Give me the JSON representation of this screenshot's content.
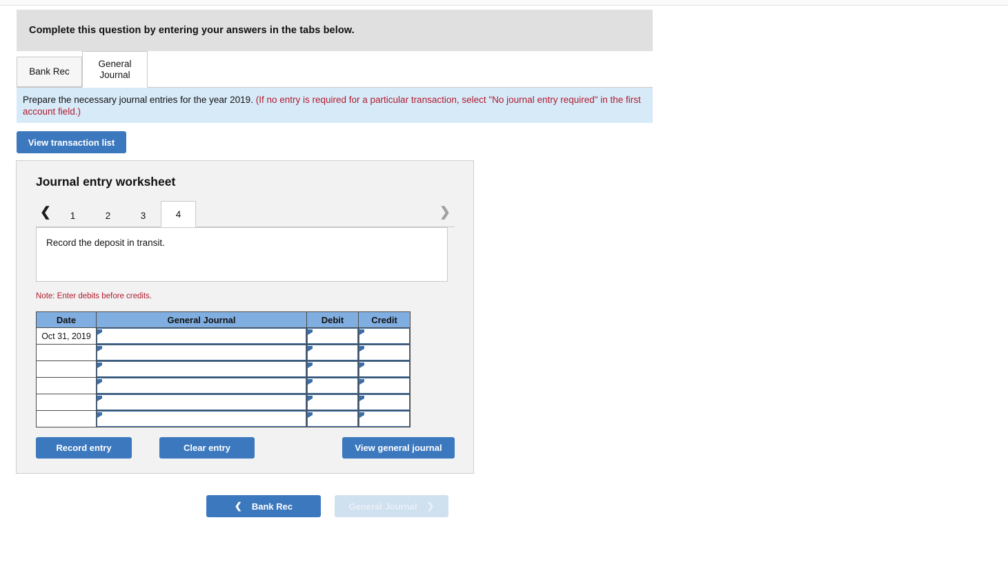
{
  "question": {
    "header": "Complete this question by entering your answers in the tabs below."
  },
  "tabs": [
    {
      "label": "Bank Rec",
      "name": "tab-bank-rec",
      "active": false
    },
    {
      "label": "General Journal",
      "name": "tab-general-journal",
      "active": true
    }
  ],
  "instructions": {
    "main": "Prepare the necessary journal entries for the year 2019.",
    "hint": "(If no entry is required for a particular transaction, select \"No journal entry required\" in the first account field.)"
  },
  "toolbar": {
    "view_transaction_list": "View transaction list"
  },
  "worksheet": {
    "title": "Journal entry worksheet",
    "pager": {
      "prev_icon": "chevron-left",
      "next_icon": "chevron-right",
      "pages": [
        "1",
        "2",
        "3",
        "4"
      ],
      "active_page": "4"
    },
    "transaction_description": "Record the deposit in transit.",
    "note": "Note: Enter debits before credits.",
    "table": {
      "columns": [
        "Date",
        "General Journal",
        "Debit",
        "Credit"
      ],
      "rows": [
        {
          "date": "Oct 31, 2019",
          "general_journal": "",
          "debit": "",
          "credit": ""
        },
        {
          "date": "",
          "general_journal": "",
          "debit": "",
          "credit": ""
        },
        {
          "date": "",
          "general_journal": "",
          "debit": "",
          "credit": ""
        },
        {
          "date": "",
          "general_journal": "",
          "debit": "",
          "credit": ""
        },
        {
          "date": "",
          "general_journal": "",
          "debit": "",
          "credit": ""
        },
        {
          "date": "",
          "general_journal": "",
          "debit": "",
          "credit": ""
        }
      ]
    },
    "actions": {
      "record_entry": "Record entry",
      "clear_entry": "Clear entry",
      "view_general_journal": "View general journal"
    }
  },
  "footer_nav": {
    "prev_label": "Bank Rec",
    "next_label": "General Journal",
    "prev_icon": "chevron-left",
    "next_icon": "chevron-right"
  },
  "colors": {
    "accent_blue": "#3c78be",
    "table_header_blue": "#81aee0",
    "banner_blue": "#d7eaf8",
    "header_gray": "#e0e0e0",
    "alert_red": "#b01b2e",
    "disabled_blue": "#cfe0ef"
  }
}
